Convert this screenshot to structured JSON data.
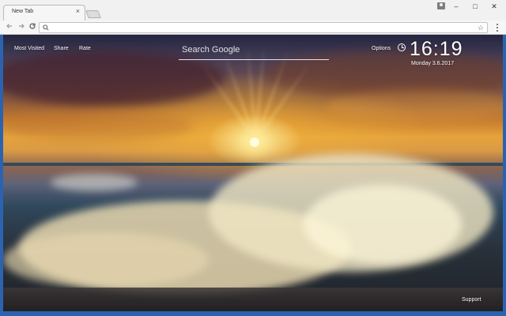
{
  "browser": {
    "tab_title": "New Tab",
    "tab_close": "×",
    "window_controls": {
      "minimize": "–",
      "maximize": "□",
      "close": "✕"
    },
    "omnibox_value": ""
  },
  "icons": {
    "back": "arrow-left-icon",
    "forward": "arrow-right-icon",
    "reload": "reload-icon",
    "search": "search-icon",
    "star": "star-icon",
    "menu": "menu-icon",
    "profile": "profile-icon",
    "clock": "clock-icon"
  },
  "ntp": {
    "links": {
      "most_visited": "Most Visited",
      "share": "Share",
      "rate": "Rate"
    },
    "search_placeholder": "Search Google",
    "options_label": "Options",
    "time": "16:19",
    "date": "Monday  3.6.2017",
    "support_label": "Support"
  },
  "colors": {
    "chrome_frame": "#2b63b0",
    "text_on_wallpaper": "#ffffff"
  }
}
